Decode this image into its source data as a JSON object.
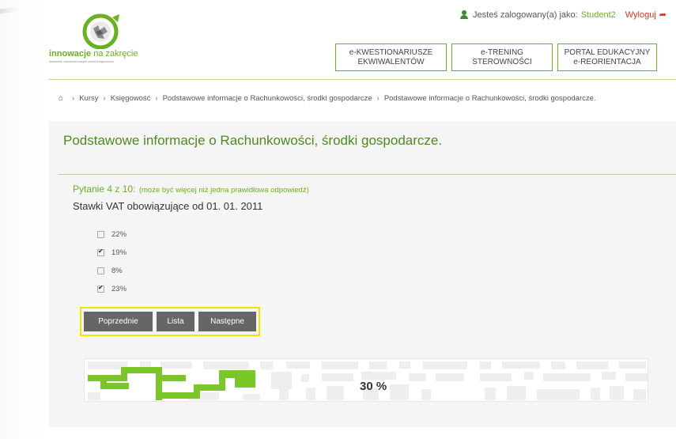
{
  "header": {
    "logo_brand_bold": "innowacje",
    "logo_brand_rest": " na zakręcie",
    "logo_tagline": "testowanie i wdrażanie nowych metod postępowania",
    "user_prefix": "Jesteś zalogowany(a) jako:",
    "username": "Student2",
    "logout_label": "Wyloguj"
  },
  "nav": [
    {
      "line1": "e-KWESTIONARIUSZE",
      "line2": "EKWIWALENTÓW"
    },
    {
      "line1": "e-TRENING",
      "line2": "STEROWNOŚCI"
    },
    {
      "line1": "PORTAL EDUKACYJNY",
      "line2": "e-REORIENTACJA"
    }
  ],
  "breadcrumb": [
    "Kursy",
    "Księgowość",
    "Podstawowe informacje o Rachunkowości, środki gospodarcze",
    "Podstawowe informacje o Rachunkowości, środki gospodarcze."
  ],
  "panel": {
    "title": "Podstawowe informacje o Rachunkowości, środki gospodarcze."
  },
  "question": {
    "number_label": "Pytanie 4 z 10:",
    "hint": "(może być więcej niż jedna prawidłowa odpowiedź)",
    "text": "Stawki VAT obowiązujące od 01. 01. 2011",
    "answers": [
      {
        "label": "22%",
        "checked": false
      },
      {
        "label": "19%",
        "checked": true
      },
      {
        "label": "8%",
        "checked": false
      },
      {
        "label": "23%",
        "checked": true
      }
    ]
  },
  "buttons": {
    "prev": "Poprzednie",
    "list": "Lista",
    "next": "Następne"
  },
  "progress": {
    "label": "30 %",
    "value": 30
  },
  "colors": {
    "accent_green": "#6ab023",
    "title_green": "#4d8b1e",
    "logout_red": "#d9321d",
    "button_gray": "#666666",
    "highlight_yellow": "#f2e200"
  }
}
